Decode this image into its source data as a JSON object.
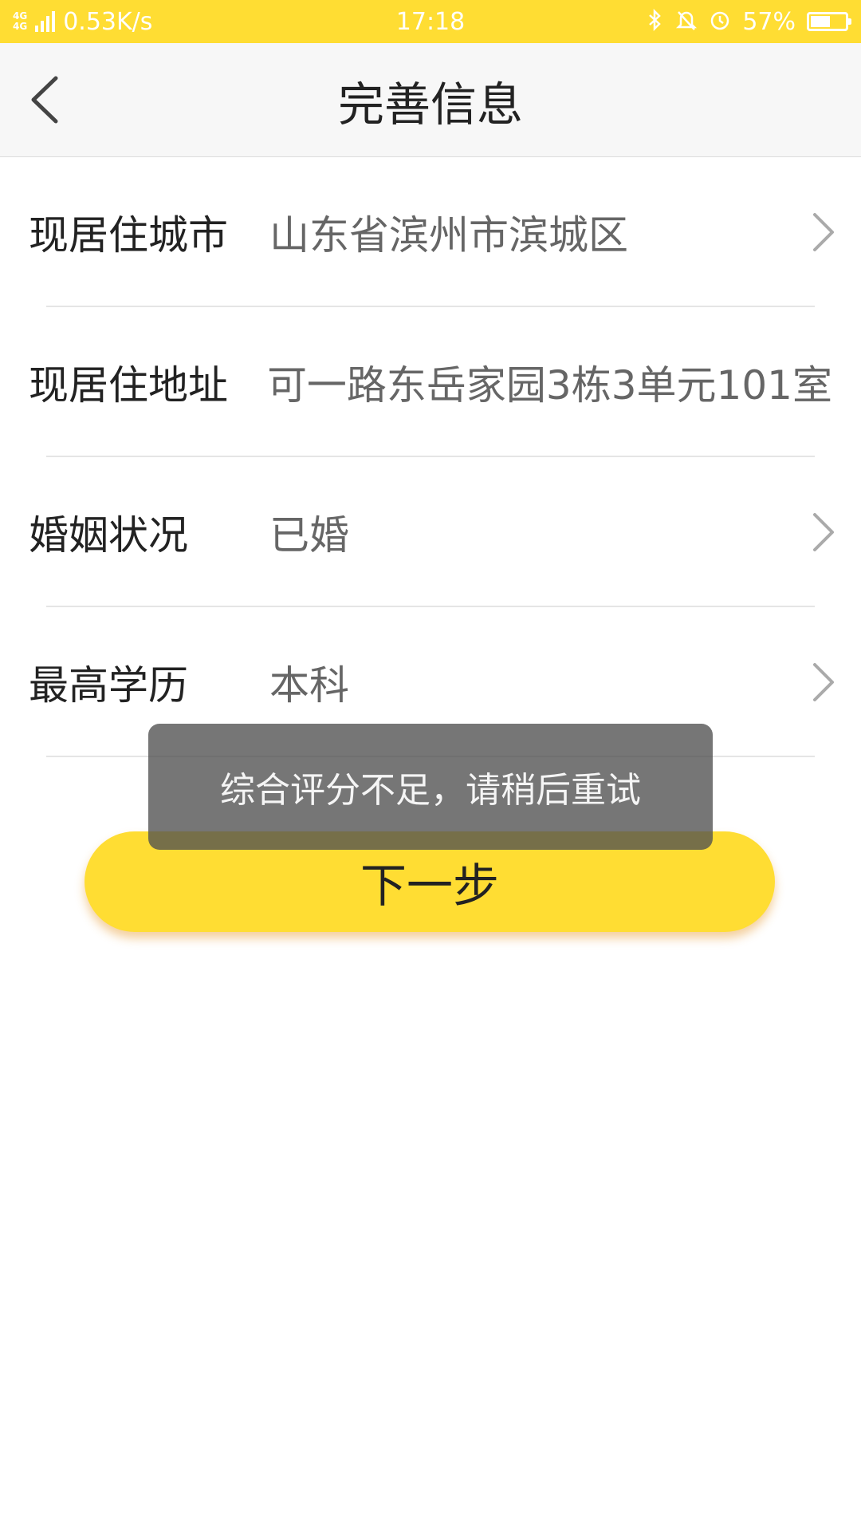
{
  "status_bar": {
    "network": "4G",
    "network_secondary": "4G",
    "speed": "0.53K/s",
    "time": "17:18",
    "battery_percent": "57%",
    "battery_level": 0.57,
    "icons": [
      "bluetooth-icon",
      "mute-bell-icon",
      "alarm-clock-icon"
    ]
  },
  "header": {
    "title": "完善信息",
    "back_icon": "chevron-left-icon"
  },
  "form": {
    "rows": [
      {
        "label": "现居住城市",
        "value": "山东省滨州市滨城区",
        "has_chevron": true
      },
      {
        "label": "现居住地址",
        "value": "可一路东岳家园3栋3单元101室",
        "has_chevron": false
      },
      {
        "label": "婚姻状况",
        "value": "已婚",
        "has_chevron": true
      },
      {
        "label": "最高学历",
        "value": "本科",
        "has_chevron": true
      }
    ]
  },
  "next_button": {
    "label": "下一步"
  },
  "toast": {
    "message": "综合评分不足，请稍后重试"
  },
  "colors": {
    "accent": "#ffdd33",
    "header_bg": "#f7f7f7",
    "toast_bg": "#505050"
  }
}
